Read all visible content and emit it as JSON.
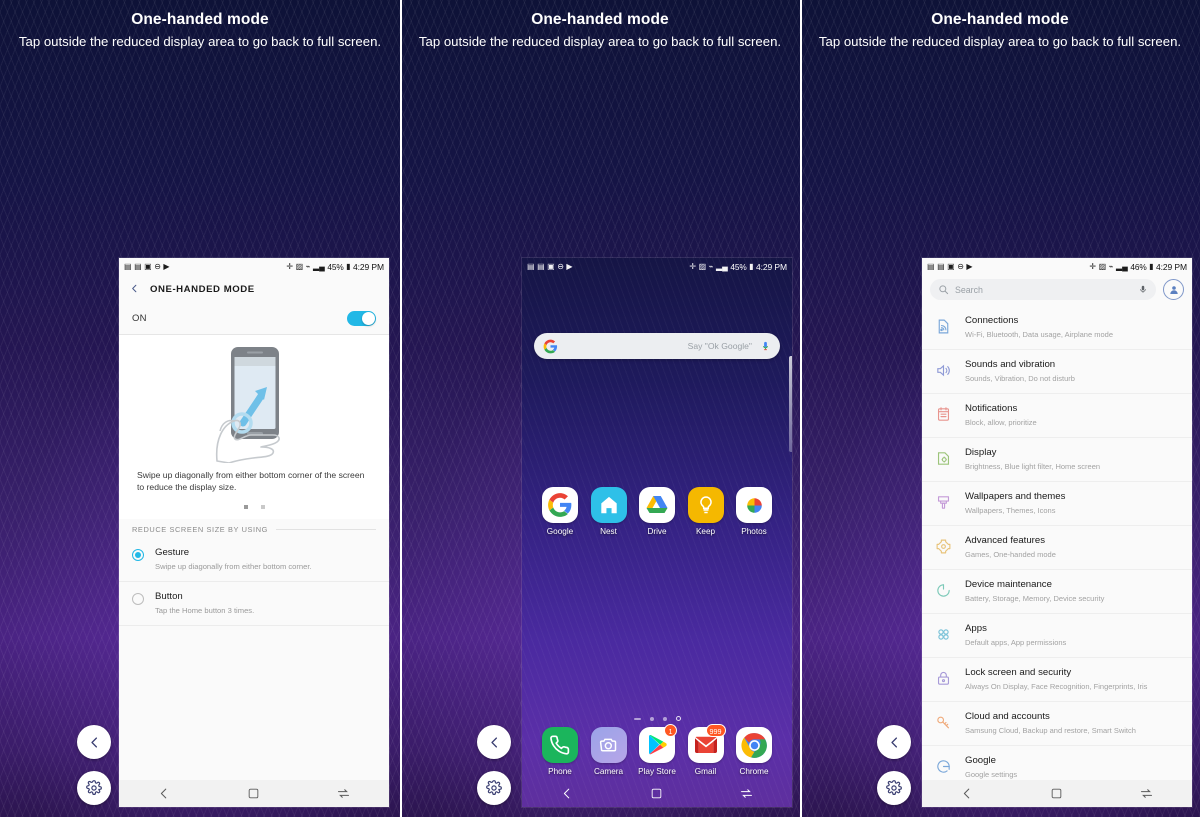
{
  "caption": {
    "title": "One-handed mode",
    "subtitle": "Tap outside the reduced display area to go back to full screen."
  },
  "fabs": {
    "back_label": "Back",
    "settings_label": "Settings",
    "back_icon": "chevron-left-icon",
    "settings_icon": "gear-icon"
  },
  "status_bar": {
    "icons_left": [
      "image-icon",
      "image-icon",
      "image-icon",
      "do-not-disturb-icon",
      "play-icon"
    ],
    "icons_right": [
      "bluetooth-icon",
      "alarm-icon",
      "wifi-icon",
      "signal-icon"
    ],
    "battery_1": "45%",
    "battery_2": "45%",
    "battery_3": "46%",
    "time": "4:29 PM"
  },
  "screen1": {
    "appbar": {
      "back_icon": "chevron-left-icon",
      "title": "ONE-HANDED MODE"
    },
    "toggle": {
      "label": "ON",
      "state": "on"
    },
    "hero": {
      "description": "Swipe up diagonally from either bottom corner of the screen to reduce the display size.",
      "dots": 2,
      "active_dot": 0
    },
    "section_header": "REDUCE SCREEN SIZE BY USING",
    "options": [
      {
        "label": "Gesture",
        "sublabel": "Swipe up diagonally from either bottom corner.",
        "selected": true
      },
      {
        "label": "Button",
        "sublabel": "Tap the Home button 3 times.",
        "selected": false
      }
    ]
  },
  "screen2": {
    "search": {
      "logo": "google-g-icon",
      "hint": "Say \"Ok Google\"",
      "mic_icon": "microphone-icon"
    },
    "apps_row": [
      {
        "name": "Google",
        "icon": "google-g-icon"
      },
      {
        "name": "Nest",
        "icon": "nest-home-icon"
      },
      {
        "name": "Drive",
        "icon": "google-drive-icon"
      },
      {
        "name": "Keep",
        "icon": "google-keep-bulb-icon"
      },
      {
        "name": "Photos",
        "icon": "google-photos-icon"
      }
    ],
    "dock_row": [
      {
        "name": "Phone",
        "icon": "phone-handset-icon",
        "badge": ""
      },
      {
        "name": "Camera",
        "icon": "camera-icon",
        "badge": ""
      },
      {
        "name": "Play Store",
        "icon": "google-play-icon",
        "badge": "1"
      },
      {
        "name": "Gmail",
        "icon": "gmail-icon",
        "badge": "999"
      },
      {
        "name": "Chrome",
        "icon": "google-chrome-icon",
        "badge": ""
      }
    ]
  },
  "screen3": {
    "search": {
      "placeholder": "Search",
      "search_icon": "search-icon",
      "mic_icon": "microphone-icon",
      "avatar_icon": "account-avatar-icon"
    },
    "items": [
      {
        "title": "Connections",
        "subtitle": "Wi-Fi, Bluetooth, Data usage, Airplane mode",
        "icon": "connections-icon",
        "color": "#7aa7d9"
      },
      {
        "title": "Sounds and vibration",
        "subtitle": "Sounds, Vibration, Do not disturb",
        "icon": "speaker-icon",
        "color": "#8f9ad6"
      },
      {
        "title": "Notifications",
        "subtitle": "Block, allow, prioritize",
        "icon": "notification-bell-icon",
        "color": "#e8948e"
      },
      {
        "title": "Display",
        "subtitle": "Brightness, Blue light filter, Home screen",
        "icon": "display-icon",
        "color": "#9cc47a"
      },
      {
        "title": "Wallpapers and themes",
        "subtitle": "Wallpapers, Themes, Icons",
        "icon": "paintbrush-icon",
        "color": "#c49ad8"
      },
      {
        "title": "Advanced features",
        "subtitle": "Games, One-handed mode",
        "icon": "advanced-features-icon",
        "color": "#e8c37a"
      },
      {
        "title": "Device maintenance",
        "subtitle": "Battery, Storage, Memory, Device security",
        "icon": "device-maintenance-icon",
        "color": "#7cc9b8"
      },
      {
        "title": "Apps",
        "subtitle": "Default apps, App permissions",
        "icon": "apps-grid-icon",
        "color": "#7fc4d9"
      },
      {
        "title": "Lock screen and security",
        "subtitle": "Always On Display, Face Recognition, Fingerprints, Iris",
        "icon": "lock-icon",
        "color": "#a79ad8"
      },
      {
        "title": "Cloud and accounts",
        "subtitle": "Samsung Cloud, Backup and restore, Smart Switch",
        "icon": "key-icon",
        "color": "#efa878"
      },
      {
        "title": "Google",
        "subtitle": "Google settings",
        "icon": "google-g-icon",
        "color": "#7aa7d9"
      }
    ]
  },
  "navbar": {
    "back_icon": "nav-back-icon",
    "home_icon": "nav-home-icon",
    "recents_icon": "nav-recents-icon"
  },
  "colors": {
    "accent": "#22b8e6",
    "background_top": "#0e1237",
    "background_bottom": "#4a2383",
    "badge": "#ff5722"
  }
}
